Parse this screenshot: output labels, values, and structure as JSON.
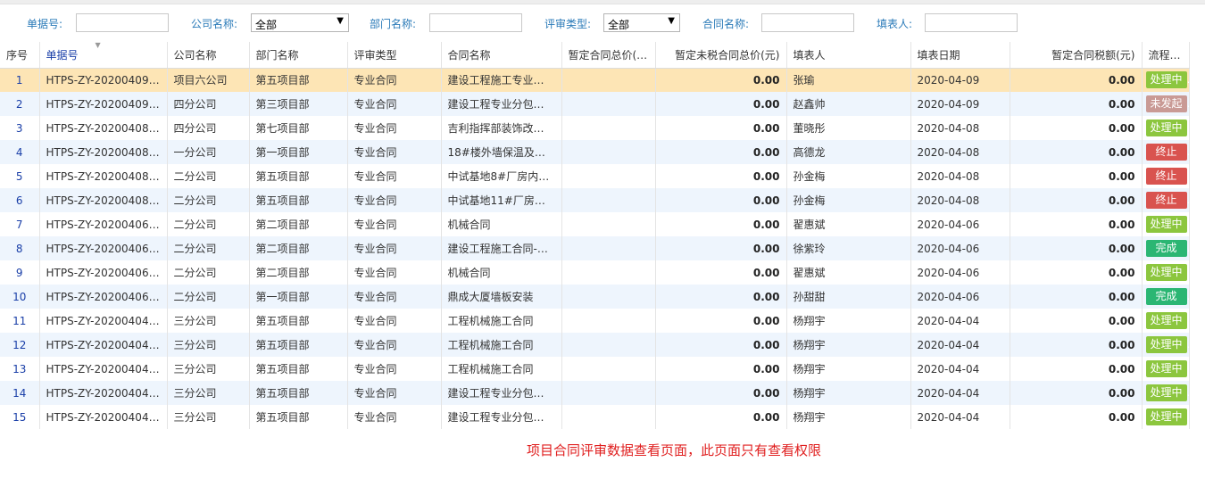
{
  "filters": {
    "doc_no_label": "单据号:",
    "doc_no_value": "",
    "company_label": "公司名称:",
    "company_value": "全部",
    "dept_label": "部门名称:",
    "dept_value": "",
    "review_type_label": "评审类型:",
    "review_type_value": "全部",
    "contract_label": "合同名称:",
    "contract_value": "",
    "filler_label": "填表人:",
    "filler_value": ""
  },
  "table": {
    "columns": [
      "序号",
      "单据号",
      "公司名称",
      "部门名称",
      "评审类型",
      "合同名称",
      "暂定合同总价(…",
      "暂定未税合同总价(元)",
      "填表人",
      "填表日期",
      "暂定合同税额(元)",
      "流程状态"
    ],
    "rows": [
      {
        "idx": "1",
        "doc": "HTPS-ZY-20200409-…",
        "company": "项目六公司",
        "dept": "第五项目部",
        "type": "专业合同",
        "contract": "建设工程施工专业…",
        "total": "",
        "untaxed": "0.00",
        "filler": "张瑜",
        "date": "2020-04-09",
        "tax": "0.00",
        "status": "处理中",
        "status_kind": "processing"
      },
      {
        "idx": "2",
        "doc": "HTPS-ZY-20200409-…",
        "company": "四分公司",
        "dept": "第三项目部",
        "type": "专业合同",
        "contract": "建设工程专业分包…",
        "total": "",
        "untaxed": "0.00",
        "filler": "赵鑫帅",
        "date": "2020-04-09",
        "tax": "0.00",
        "status": "未发起",
        "status_kind": "not-started"
      },
      {
        "idx": "3",
        "doc": "HTPS-ZY-20200408-…",
        "company": "四分公司",
        "dept": "第七项目部",
        "type": "专业合同",
        "contract": "吉利指挥部装饰改…",
        "total": "",
        "untaxed": "0.00",
        "filler": "董晓彤",
        "date": "2020-04-08",
        "tax": "0.00",
        "status": "处理中",
        "status_kind": "processing"
      },
      {
        "idx": "4",
        "doc": "HTPS-ZY-20200408-…",
        "company": "一分公司",
        "dept": "第一项目部",
        "type": "专业合同",
        "contract": "18#楼外墙保温及水…",
        "total": "",
        "untaxed": "0.00",
        "filler": "高德龙",
        "date": "2020-04-08",
        "tax": "0.00",
        "status": "终止",
        "status_kind": "terminated"
      },
      {
        "idx": "5",
        "doc": "HTPS-ZY-20200408-…",
        "company": "二分公司",
        "dept": "第五项目部",
        "type": "专业合同",
        "contract": "中试基地8#厂房内…",
        "total": "",
        "untaxed": "0.00",
        "filler": "孙金梅",
        "date": "2020-04-08",
        "tax": "0.00",
        "status": "终止",
        "status_kind": "terminated"
      },
      {
        "idx": "6",
        "doc": "HTPS-ZY-20200408-…",
        "company": "二分公司",
        "dept": "第五项目部",
        "type": "专业合同",
        "contract": "中试基地11#厂房内…",
        "total": "",
        "untaxed": "0.00",
        "filler": "孙金梅",
        "date": "2020-04-08",
        "tax": "0.00",
        "status": "终止",
        "status_kind": "terminated"
      },
      {
        "idx": "7",
        "doc": "HTPS-ZY-20200406-…",
        "company": "二分公司",
        "dept": "第二项目部",
        "type": "专业合同",
        "contract": "机械合同",
        "total": "",
        "untaxed": "0.00",
        "filler": "翟惠斌",
        "date": "2020-04-06",
        "tax": "0.00",
        "status": "处理中",
        "status_kind": "processing"
      },
      {
        "idx": "8",
        "doc": "HTPS-ZY-20200406-…",
        "company": "二分公司",
        "dept": "第二项目部",
        "type": "专业合同",
        "contract": "建设工程施工合同-…",
        "total": "",
        "untaxed": "0.00",
        "filler": "徐紫玲",
        "date": "2020-04-06",
        "tax": "0.00",
        "status": "完成",
        "status_kind": "done"
      },
      {
        "idx": "9",
        "doc": "HTPS-ZY-20200406-…",
        "company": "二分公司",
        "dept": "第二项目部",
        "type": "专业合同",
        "contract": "机械合同",
        "total": "",
        "untaxed": "0.00",
        "filler": "翟惠斌",
        "date": "2020-04-06",
        "tax": "0.00",
        "status": "处理中",
        "status_kind": "processing"
      },
      {
        "idx": "10",
        "doc": "HTPS-ZY-20200406-…",
        "company": "二分公司",
        "dept": "第一项目部",
        "type": "专业合同",
        "contract": "鼎成大厦墙板安装",
        "total": "",
        "untaxed": "0.00",
        "filler": "孙甜甜",
        "date": "2020-04-06",
        "tax": "0.00",
        "status": "完成",
        "status_kind": "done"
      },
      {
        "idx": "11",
        "doc": "HTPS-ZY-20200404-…",
        "company": "三分公司",
        "dept": "第五项目部",
        "type": "专业合同",
        "contract": "工程机械施工合同",
        "total": "",
        "untaxed": "0.00",
        "filler": "杨翔宇",
        "date": "2020-04-04",
        "tax": "0.00",
        "status": "处理中",
        "status_kind": "processing"
      },
      {
        "idx": "12",
        "doc": "HTPS-ZY-20200404-…",
        "company": "三分公司",
        "dept": "第五项目部",
        "type": "专业合同",
        "contract": "工程机械施工合同",
        "total": "",
        "untaxed": "0.00",
        "filler": "杨翔宇",
        "date": "2020-04-04",
        "tax": "0.00",
        "status": "处理中",
        "status_kind": "processing"
      },
      {
        "idx": "13",
        "doc": "HTPS-ZY-20200404-…",
        "company": "三分公司",
        "dept": "第五项目部",
        "type": "专业合同",
        "contract": "工程机械施工合同",
        "total": "",
        "untaxed": "0.00",
        "filler": "杨翔宇",
        "date": "2020-04-04",
        "tax": "0.00",
        "status": "处理中",
        "status_kind": "processing"
      },
      {
        "idx": "14",
        "doc": "HTPS-ZY-20200404-…",
        "company": "三分公司",
        "dept": "第五项目部",
        "type": "专业合同",
        "contract": "建设工程专业分包…",
        "total": "",
        "untaxed": "0.00",
        "filler": "杨翔宇",
        "date": "2020-04-04",
        "tax": "0.00",
        "status": "处理中",
        "status_kind": "processing"
      },
      {
        "idx": "15",
        "doc": "HTPS-ZY-20200404-…",
        "company": "三分公司",
        "dept": "第五项目部",
        "type": "专业合同",
        "contract": "建设工程专业分包…",
        "total": "",
        "untaxed": "0.00",
        "filler": "杨翔宇",
        "date": "2020-04-04",
        "tax": "0.00",
        "status": "处理中",
        "status_kind": "processing"
      }
    ],
    "selected_row": 0
  },
  "notice": "项目合同评审数据查看页面，此页面只有查看权限",
  "icons": {
    "sort": "sort-caret-icon",
    "dropdown": "chevron-down-icon"
  }
}
